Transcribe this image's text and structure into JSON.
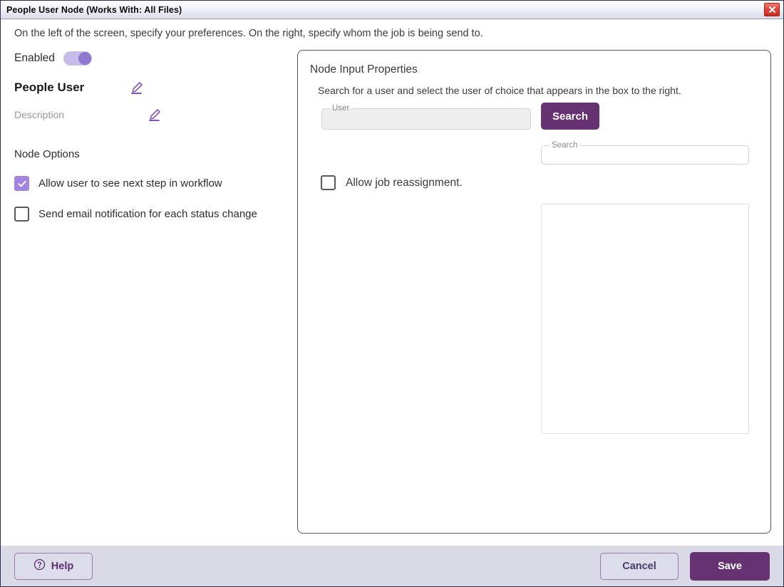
{
  "window": {
    "title": "People User Node (Works With: All Files)",
    "close_icon": "close-icon"
  },
  "instruction": "On the left of the screen, specify your preferences. On the right, specify whom the job is being send to.",
  "left": {
    "enabled_label": "Enabled",
    "enabled_state": "on",
    "node_name": "People User",
    "node_name_edit_icon": "pencil-icon",
    "description_placeholder": "Description",
    "description_edit_icon": "pencil-icon",
    "section_title": "Node Options",
    "options": [
      {
        "label": "Allow user to see next step in workflow",
        "checked": true
      },
      {
        "label": "Send email notification for each status change",
        "checked": false
      }
    ]
  },
  "panel": {
    "title": "Node Input Properties",
    "subtitle": "Search for a user and select the user of choice that appears in the box to the right.",
    "user_field": {
      "legend": "User",
      "value": "",
      "placeholder": ""
    },
    "search_button": "Search",
    "search_field": {
      "legend": "Search",
      "value": "",
      "placeholder": ""
    },
    "reassign": {
      "label": "Allow job reassignment.",
      "checked": false
    },
    "results": []
  },
  "footer": {
    "help_label": "Help",
    "help_icon": "question-circle-icon",
    "cancel_label": "Cancel",
    "save_label": "Save"
  },
  "colors": {
    "accent": "#663271",
    "toggle_on": "#8f79d0",
    "checkbox_checked": "#a384e0",
    "footer_bg": "#dadae6",
    "close_red": "#d32f1e"
  }
}
